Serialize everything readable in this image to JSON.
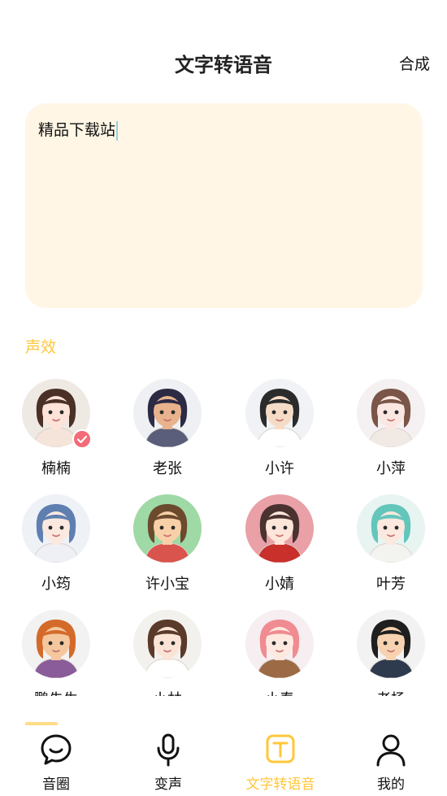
{
  "header": {
    "title": "文字转语音",
    "compose_label": "合成"
  },
  "editor": {
    "text": "精品下载站"
  },
  "section": {
    "label": "声效"
  },
  "voices": [
    {
      "name": "楠楠",
      "selected": true,
      "colors": {
        "bg": "#efe9e4",
        "hair": "#4a3026",
        "face": "#fde3d8",
        "cloth": "#f4e4da"
      }
    },
    {
      "name": "老张",
      "colors": {
        "bg": "#eef0f3",
        "hair": "#2c2a44",
        "face": "#e8b28d",
        "cloth": "#5a5e7a"
      }
    },
    {
      "name": "小许",
      "colors": {
        "bg": "#f0f2f5",
        "hair": "#2b2b2b",
        "face": "#f6dcc6",
        "cloth": "#ffffff"
      }
    },
    {
      "name": "小萍",
      "colors": {
        "bg": "#f5f1f2",
        "hair": "#7a5548",
        "face": "#fbe7e1",
        "cloth": "#f1e9e4"
      }
    },
    {
      "name": "小筠",
      "colors": {
        "bg": "#eef2f7",
        "hair": "#5e7fb0",
        "face": "#fbe8df",
        "cloth": "#eef0f5"
      }
    },
    {
      "name": "许小宝",
      "colors": {
        "bg": "#9fd9a5",
        "hair": "#6b4a2e",
        "face": "#f8d0a8",
        "cloth": "#d9544c"
      }
    },
    {
      "name": "小婧",
      "colors": {
        "bg": "#e9a0a7",
        "hair": "#4a3230",
        "face": "#fde5d9",
        "cloth": "#c9302c"
      }
    },
    {
      "name": "叶芳",
      "colors": {
        "bg": "#e8f4f2",
        "hair": "#63c6bb",
        "face": "#fbe9df",
        "cloth": "#f3f3ef"
      }
    },
    {
      "name": "鹏先生",
      "colors": {
        "bg": "#f2f2f2",
        "hair": "#d46a2a",
        "face": "#f5c79e",
        "cloth": "#8a5c9a"
      }
    },
    {
      "name": "小林",
      "colors": {
        "bg": "#f3f1ee",
        "hair": "#5a3a2a",
        "face": "#fbe4d6",
        "cloth": "#ffffff"
      }
    },
    {
      "name": "小春",
      "colors": {
        "bg": "#f6eef0",
        "hair": "#f08b92",
        "face": "#fde9df",
        "cloth": "#9c6b45"
      }
    },
    {
      "name": "老杨",
      "colors": {
        "bg": "#f2f2f2",
        "hair": "#1f1f1f",
        "face": "#f7d2b1",
        "cloth": "#2e3a4e"
      }
    }
  ],
  "tabs": [
    {
      "label": "音圈",
      "icon": "chat-bubble-icon",
      "active": false
    },
    {
      "label": "变声",
      "icon": "microphone-icon",
      "active": false
    },
    {
      "label": "文字转语音",
      "icon": "text-t-icon",
      "active": true
    },
    {
      "label": "我的",
      "icon": "person-icon",
      "active": false
    }
  ],
  "theme": {
    "accent": "#ffc739",
    "editor_bg": "#fff6e5",
    "check": "#f36b78"
  }
}
